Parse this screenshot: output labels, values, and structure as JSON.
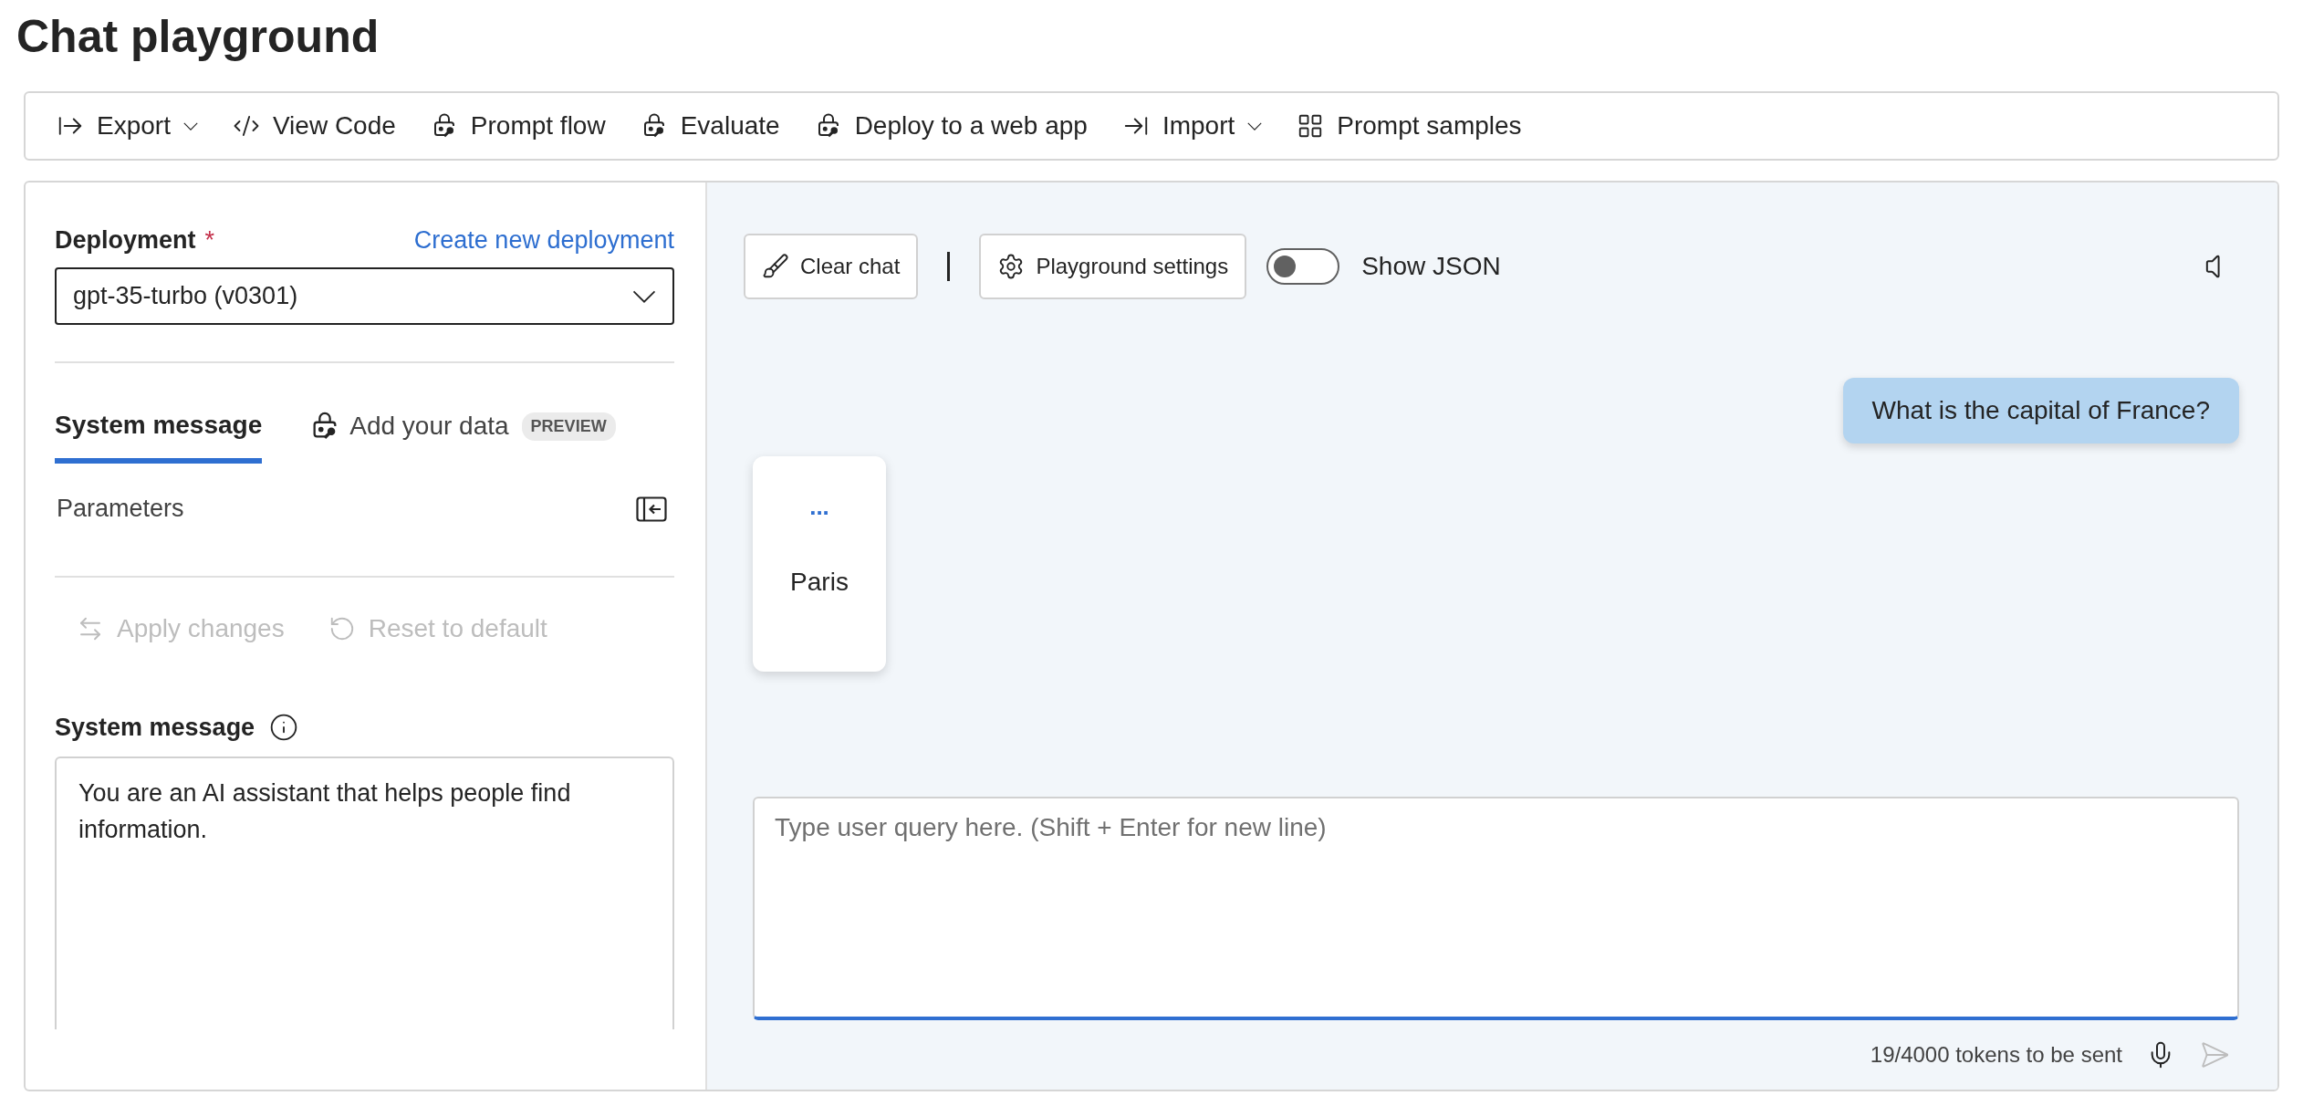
{
  "page_title": "Chat playground",
  "toolbar": [
    {
      "label": "Export",
      "kind": "export",
      "has_menu": true
    },
    {
      "label": "View Code",
      "kind": "code",
      "has_menu": false
    },
    {
      "label": "Prompt flow",
      "kind": "lock",
      "has_menu": false
    },
    {
      "label": "Evaluate",
      "kind": "lock",
      "has_menu": false
    },
    {
      "label": "Deploy to a web app",
      "kind": "lock",
      "has_menu": false
    },
    {
      "label": "Import",
      "kind": "import",
      "has_menu": true
    },
    {
      "label": "Prompt samples",
      "kind": "grid",
      "has_menu": false
    }
  ],
  "setup": {
    "deployment_label": "Deployment",
    "required_mark": "*",
    "create_link": "Create new deployment",
    "deployment_value": "gpt-35-turbo (v0301)",
    "tabs": [
      {
        "label": "System message",
        "selected": true
      },
      {
        "label": "Add your data",
        "badge": "PREVIEW",
        "selected": false
      }
    ],
    "parameters_label": "Parameters",
    "actions": [
      {
        "label": "Apply changes",
        "kind": "apply",
        "disabled": true
      },
      {
        "label": "Reset to default",
        "kind": "reset",
        "disabled": true
      }
    ],
    "system_message_label": "System message",
    "system_message_value": "You are an AI assistant that helps people find information."
  },
  "chat": {
    "clear_button": "Clear chat",
    "settings_button": "Playground settings",
    "json_toggle": {
      "label": "Show JSON",
      "on": false
    },
    "messages": [
      {
        "kind": "user",
        "text": "What is the capital of France?"
      },
      {
        "kind": "assistant",
        "menu": "...",
        "text": "Paris"
      }
    ],
    "input_placeholder": "Type user query here. (Shift + Enter for new line)",
    "token_count": "19/4000 tokens to be sent"
  }
}
